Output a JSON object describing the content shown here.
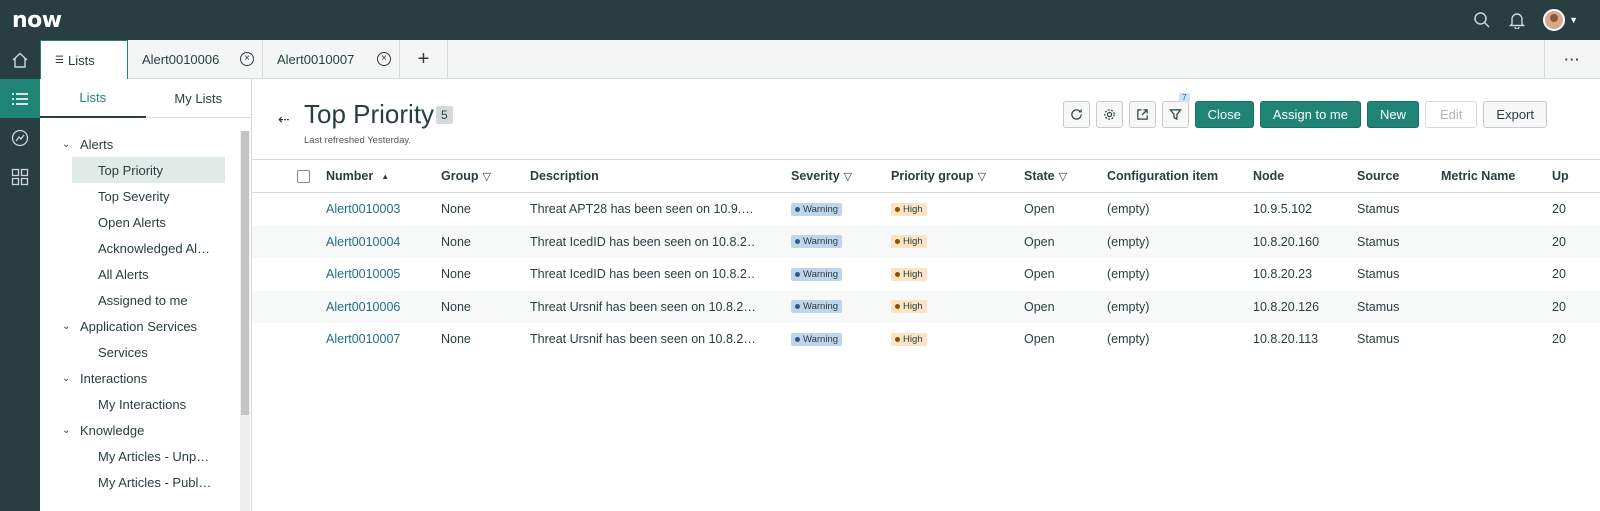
{
  "header": {
    "logo": "now",
    "logo_dot": "."
  },
  "tabs": [
    {
      "label": "Lists"
    },
    {
      "label": "Alert0010006"
    },
    {
      "label": "Alert0010007"
    }
  ],
  "tab_add": "+",
  "tab_more": "···",
  "left_panel": {
    "tabs": [
      "Lists",
      "My Lists"
    ],
    "tree": [
      {
        "group": "Alerts",
        "items": [
          "Top Priority",
          "Top Severity",
          "Open Alerts",
          "Acknowledged Al…",
          "All Alerts",
          "Assigned to me"
        ]
      },
      {
        "group": "Application Services",
        "items": [
          "Services"
        ]
      },
      {
        "group": "Interactions",
        "items": [
          "My Interactions"
        ]
      },
      {
        "group": "Knowledge",
        "items": [
          "My Articles - Unp…",
          "My Articles - Publ…"
        ]
      }
    ]
  },
  "main": {
    "title": "Top Priority",
    "count": "5",
    "refreshed": "Last refreshed Yesterday.",
    "filter_count": "7",
    "buttons": {
      "close": "Close",
      "assign": "Assign to me",
      "new": "New",
      "edit": "Edit",
      "export": "Export"
    }
  },
  "table": {
    "columns": [
      "Number",
      "Group",
      "Description",
      "Severity",
      "Priority group",
      "State",
      "Configuration item",
      "Node",
      "Source",
      "Metric Name",
      "Up"
    ],
    "rows": [
      {
        "number": "Alert0010003",
        "group": "None",
        "description": "Threat APT28 has been seen on 10.9.…",
        "severity": "Warning",
        "priority": "High",
        "state": "Open",
        "ci": "(empty)",
        "node": "10.9.5.102",
        "source": "Stamus",
        "metric": "",
        "updated": "20"
      },
      {
        "number": "Alert0010004",
        "group": "None",
        "description": "Threat IcedID has been seen on 10.8.2…",
        "severity": "Warning",
        "priority": "High",
        "state": "Open",
        "ci": "(empty)",
        "node": "10.8.20.160",
        "source": "Stamus",
        "metric": "",
        "updated": "20"
      },
      {
        "number": "Alert0010005",
        "group": "None",
        "description": "Threat IcedID has been seen on 10.8.2…",
        "severity": "Warning",
        "priority": "High",
        "state": "Open",
        "ci": "(empty)",
        "node": "10.8.20.23",
        "source": "Stamus",
        "metric": "",
        "updated": "20"
      },
      {
        "number": "Alert0010006",
        "group": "None",
        "description": "Threat Ursnif has been seen on 10.8.2…",
        "severity": "Warning",
        "priority": "High",
        "state": "Open",
        "ci": "(empty)",
        "node": "10.8.20.126",
        "source": "Stamus",
        "metric": "",
        "updated": "20"
      },
      {
        "number": "Alert0010007",
        "group": "None",
        "description": "Threat Ursnif has been seen on 10.8.2…",
        "severity": "Warning",
        "priority": "High",
        "state": "Open",
        "ci": "(empty)",
        "node": "10.8.20.113",
        "source": "Stamus",
        "metric": "",
        "updated": "20"
      }
    ]
  },
  "colors": {
    "header_bg": "#293e40",
    "accent": "#1f8476",
    "link": "#1f6e8c",
    "severity_bg": "#bed5ec",
    "priority_bg": "#fbe3c4"
  }
}
